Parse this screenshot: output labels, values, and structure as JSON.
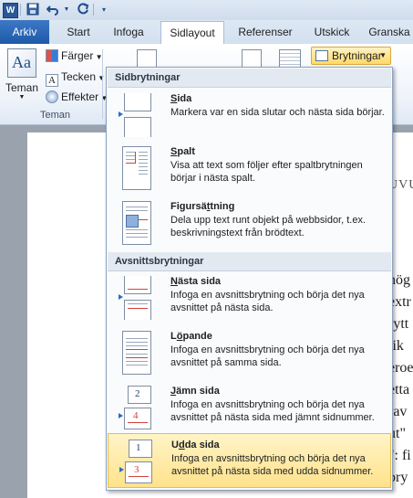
{
  "ribbon_tabs": [
    "Arkiv",
    "Start",
    "Infoga",
    "Sidlayout",
    "Referenser",
    "Utskick",
    "Granska"
  ],
  "active_tab": "Sidlayout",
  "theme_group": {
    "button_label": "Teman",
    "items": [
      "Färger",
      "Tecken",
      "Effekter"
    ],
    "group_label": "Teman"
  },
  "breaks_button": {
    "label": "Brytningar"
  },
  "menu": {
    "sections": [
      {
        "header": "Sidbrytningar",
        "items": [
          {
            "title": "Sida",
            "desc": "Markera var en sida slutar och nästa sida börjar."
          },
          {
            "title": "Spalt",
            "desc": "Visa att text som följer efter spaltbrytningen börjar i nästa spalt."
          },
          {
            "title": "Figursättning",
            "desc": "Dela upp text runt objekt på webbsidor, t.ex. beskrivningstext från brödtext."
          }
        ]
      },
      {
        "header": "Avsnittsbrytningar",
        "items": [
          {
            "title": "Nästa sida",
            "desc": "Infoga en avsnittsbrytning och börja det nya avsnittet på nästa sida."
          },
          {
            "title": "Löpande",
            "desc": "Infoga en avsnittsbrytning och börja det nya avsnittet på samma sida."
          },
          {
            "title": "Jämn sida",
            "desc": "Infoga en avsnittsbrytning och börja det nya avsnittet på nästa sida med jämnt sidnummer."
          },
          {
            "title": "Udda sida",
            "desc": "Infoga en avsnittsbrytning och börja det nya avsnittet på nästa sida med udda sidnummer."
          }
        ]
      }
    ],
    "highlighted_item": "Udda sida"
  },
  "document_fragments": [
    "UVU",
    "hög",
    "extr",
    "rytt",
    "tik",
    "eroe",
    "etta",
    "rav",
    "ut\"",
    "\": fi",
    "bry"
  ],
  "icons": {
    "app": "word-logo-icon",
    "save": "save-icon",
    "undo": "undo-icon",
    "redo": "redo-icon",
    "customize": "customize-qat-icon",
    "themes": "themes-icon",
    "colors": "theme-colors-icon",
    "fonts": "theme-fonts-icon",
    "effects": "theme-effects-icon",
    "breaks": "breaks-icon"
  },
  "colors": {
    "file_tab": "#2b62b0",
    "highlight": "#ffe28b",
    "menu_header": "#e3e9f1",
    "break_marker": "#d0443c"
  }
}
